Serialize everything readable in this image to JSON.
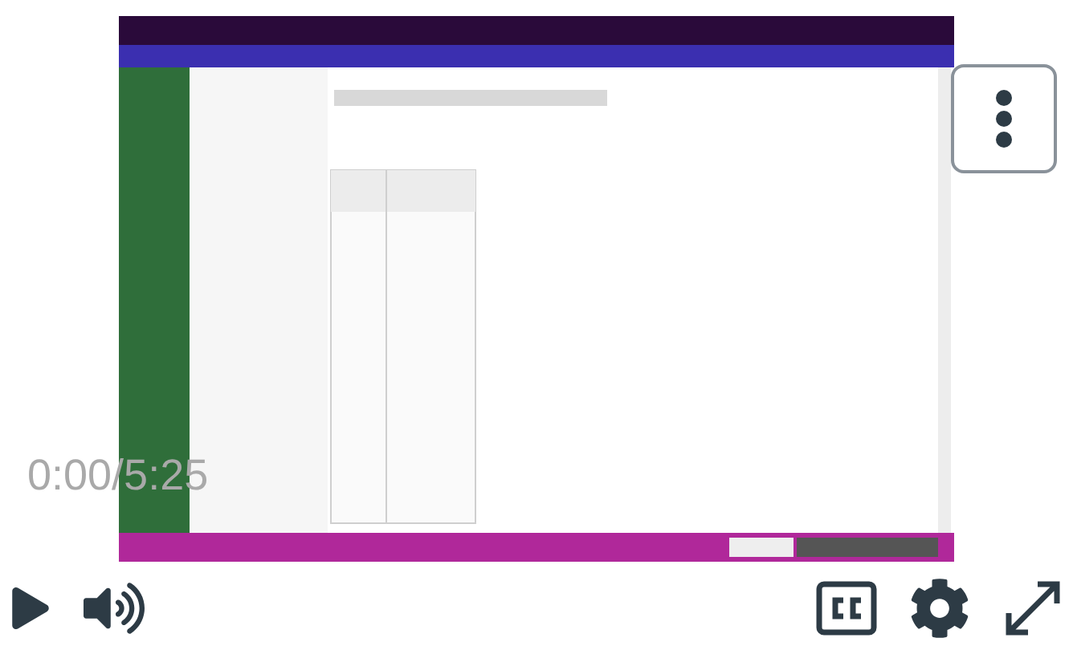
{
  "player": {
    "time": "0:00/5:25",
    "playing": false,
    "muted": false
  }
}
